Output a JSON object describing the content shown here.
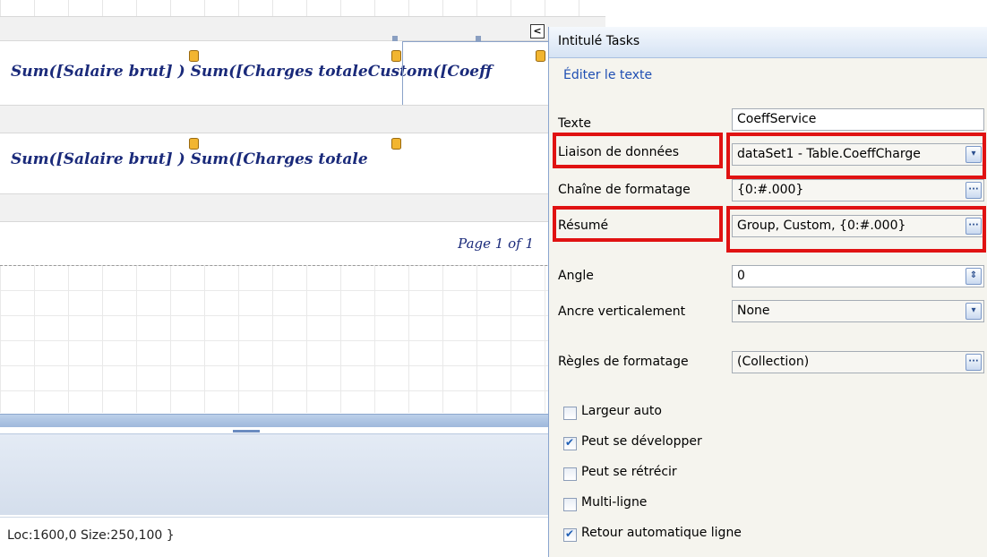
{
  "designer": {
    "row1": "Sum([Salaire brut] ) Sum([Charges totaleCustom([Coeff",
    "row2": "Sum([Salaire brut] ) Sum([Charges totale",
    "page_text": "Page 1 of 1",
    "smart_tag": "<",
    "status": "Loc:1600,0 Size:250,100 }"
  },
  "panel": {
    "title": "Intitulé Tasks",
    "edit_link": "Éditer le texte",
    "properties": [
      {
        "label": "Texte",
        "value": "CoeffService",
        "button": ""
      },
      {
        "label": "Liaison de données",
        "value": "dataSet1 - Table.CoeffCharge",
        "button": "dropdown"
      },
      {
        "label": "Chaîne de formatage",
        "value": "{0:#.000}",
        "button": "ellipsis"
      },
      {
        "label": "Résumé",
        "value": "Group, Custom, {0:#.000}",
        "button": "ellipsis"
      },
      {
        "label": "Angle",
        "value": "0",
        "button": "spinner"
      },
      {
        "label": "Ancre verticalement",
        "value": "None",
        "button": "dropdown"
      },
      {
        "label": "Règles de formatage",
        "value": "(Collection)",
        "button": "ellipsis"
      }
    ],
    "glyphs": {
      "dropdown": "▾",
      "ellipsis": "···",
      "spinner": "⇕"
    },
    "checkboxes": [
      {
        "label": "Largeur auto",
        "checked": false
      },
      {
        "label": "Peut se développer",
        "checked": true
      },
      {
        "label": "Peut se rétrécir",
        "checked": false
      },
      {
        "label": "Multi-ligne",
        "checked": false
      },
      {
        "label": "Retour automatique ligne",
        "checked": true
      }
    ]
  },
  "colors": {
    "highlight": "#e01212",
    "report_text": "#1a2a7a",
    "link": "#1f4fb3"
  }
}
